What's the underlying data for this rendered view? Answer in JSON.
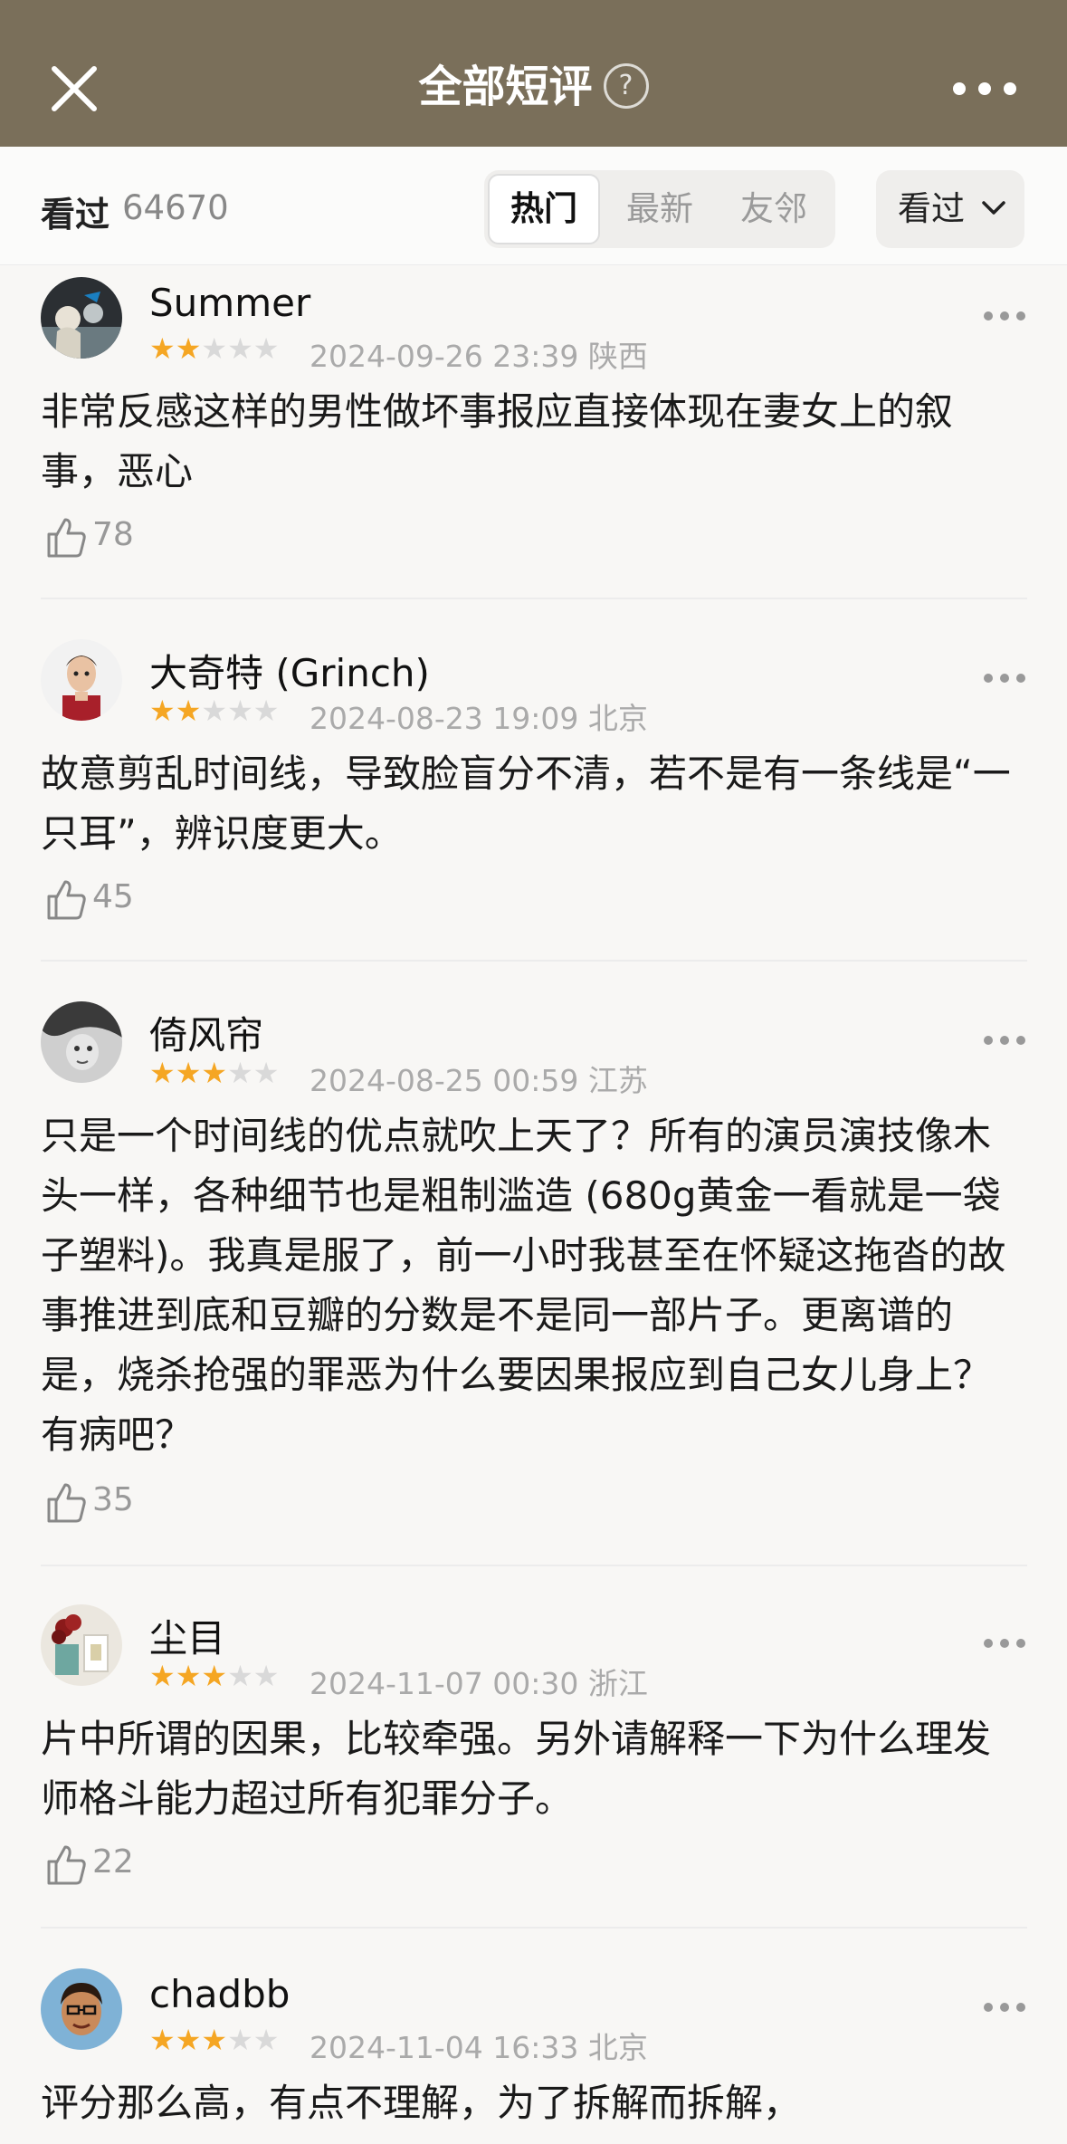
{
  "header": {
    "title": "全部短评",
    "help_icon": "?",
    "colors": {
      "background": "#7a6f5a"
    }
  },
  "subbar": {
    "seen_label": "看过",
    "seen_count": "64670",
    "tabs": [
      "热门",
      "最新",
      "友邻"
    ],
    "active_tab": "热门",
    "filter_label": "看过"
  },
  "comments": [
    {
      "author": "Summer",
      "rating": 2,
      "datetime": "2024-09-26 23:39",
      "location": "陕西",
      "text": "非常反感这样的男性做坏事报应直接体现在妻女上的叙事，恶心",
      "likes": "78"
    },
    {
      "author": "大奇特 (Grinch)",
      "rating": 2,
      "datetime": "2024-08-23 19:09",
      "location": "北京",
      "text": "故意剪乱时间线，导致脸盲分不清，若不是有一条线是“一只耳”，辨识度更大。",
      "likes": "45"
    },
    {
      "author": "倚风帘",
      "rating": 3,
      "datetime": "2024-08-25 00:59",
      "location": "江苏",
      "text": "只是一个时间线的优点就吹上天了？所有的演员演技像木头一样，各种细节也是粗制滥造 (680g黄金一看就是一袋子塑料)。我真是服了，前一小时我甚至在怀疑这拖沓的故事推进到底和豆瓣的分数是不是同一部片子。更离谱的是，烧杀抢强的罪恶为什么要因果报应到自己女儿身上？有病吧？",
      "likes": "35"
    },
    {
      "author": "尘目",
      "rating": 3,
      "datetime": "2024-11-07 00:30",
      "location": "浙江",
      "text": "片中所谓的因果，比较牵强。另外请解释一下为什么理发师格斗能力超过所有犯罪分子。",
      "likes": "22"
    },
    {
      "author": "chadbb",
      "rating": 3,
      "datetime": "2024-11-04 16:33",
      "location": "北京",
      "text": "评分那么高，有点不理解，为了拆解而拆解，",
      "likes": ""
    }
  ]
}
